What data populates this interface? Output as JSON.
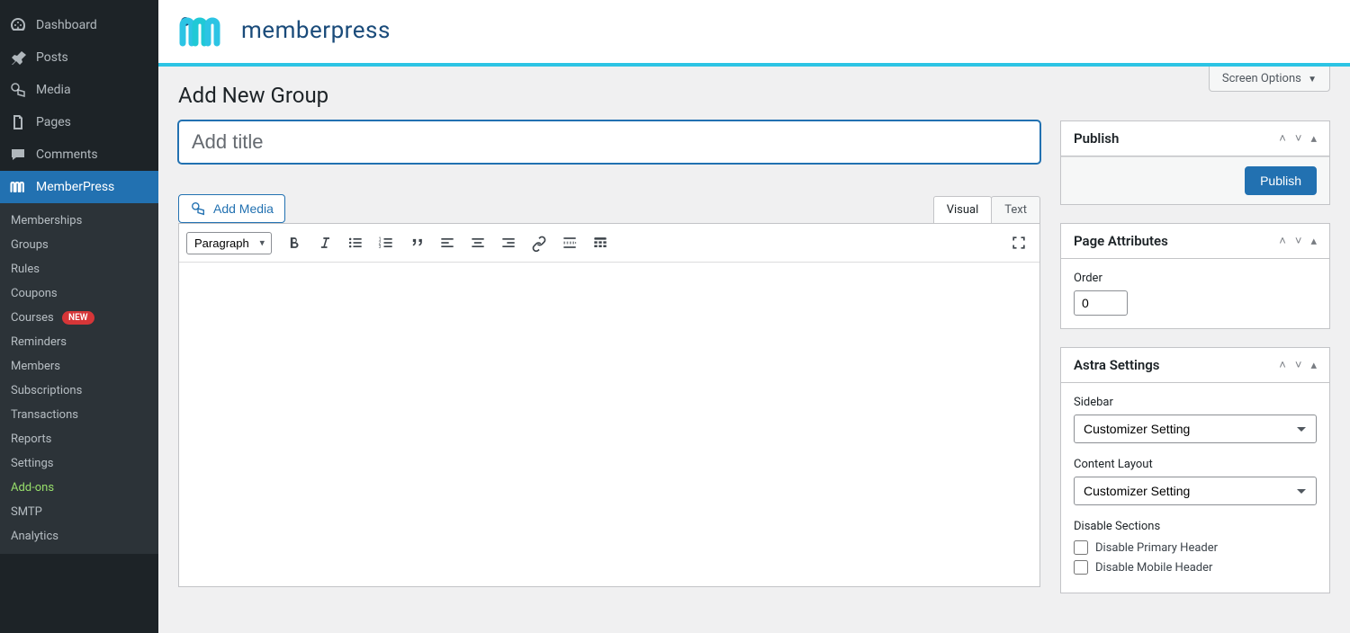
{
  "sidebar": {
    "main": [
      {
        "label": "Dashboard",
        "icon": "dashboard"
      },
      {
        "label": "Posts",
        "icon": "pin"
      },
      {
        "label": "Media",
        "icon": "media"
      },
      {
        "label": "Pages",
        "icon": "pages"
      },
      {
        "label": "Comments",
        "icon": "comments"
      },
      {
        "label": "MemberPress",
        "icon": "memberpress",
        "active": true
      }
    ],
    "sub": [
      {
        "label": "Memberships"
      },
      {
        "label": "Groups"
      },
      {
        "label": "Rules"
      },
      {
        "label": "Coupons"
      },
      {
        "label": "Courses",
        "badge": "NEW"
      },
      {
        "label": "Reminders"
      },
      {
        "label": "Members"
      },
      {
        "label": "Subscriptions"
      },
      {
        "label": "Transactions"
      },
      {
        "label": "Reports"
      },
      {
        "label": "Settings"
      },
      {
        "label": "Add-ons",
        "highlight": true
      },
      {
        "label": "SMTP"
      },
      {
        "label": "Analytics"
      }
    ]
  },
  "brand": {
    "name": "memberpress"
  },
  "screen_options": "Screen Options",
  "page_title": "Add New Group",
  "editor": {
    "title_placeholder": "Add title",
    "add_media": "Add Media",
    "tabs": {
      "visual": "Visual",
      "text": "Text"
    },
    "paragraph": "Paragraph"
  },
  "publish_box": {
    "title": "Publish",
    "button": "Publish"
  },
  "page_attr": {
    "title": "Page Attributes",
    "order_label": "Order",
    "order_value": "0"
  },
  "astra": {
    "title": "Astra Settings",
    "sidebar_label": "Sidebar",
    "sidebar_value": "Customizer Setting",
    "content_label": "Content Layout",
    "content_value": "Customizer Setting",
    "disable_label": "Disable Sections",
    "disable_options": [
      "Disable Primary Header",
      "Disable Mobile Header"
    ]
  }
}
